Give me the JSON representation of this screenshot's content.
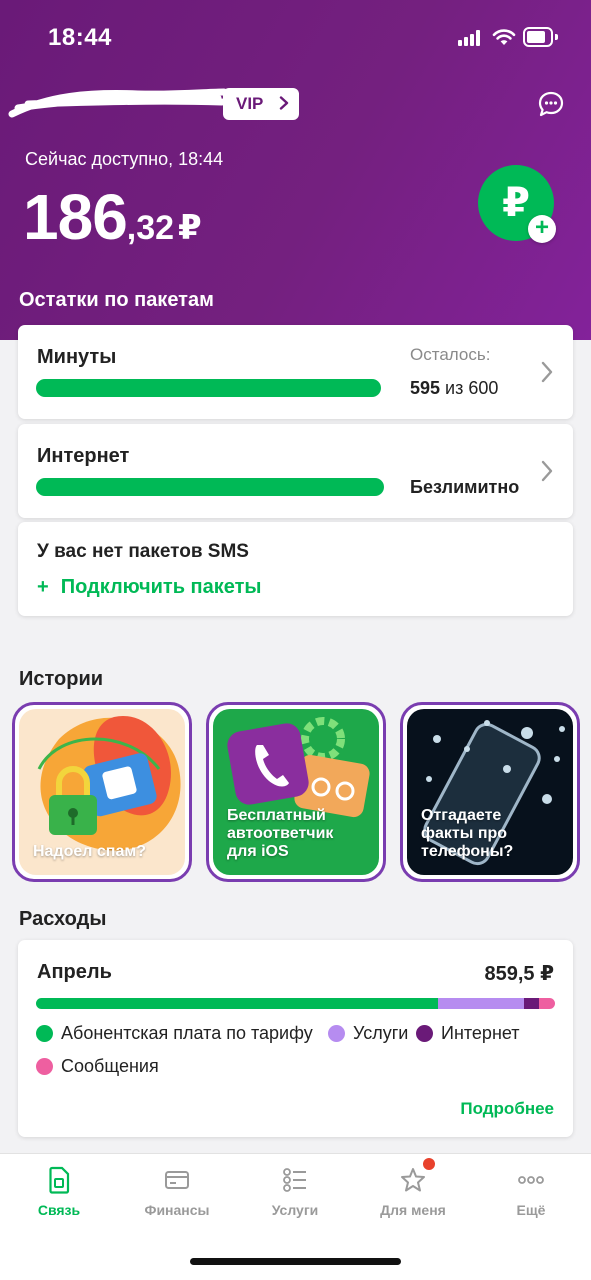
{
  "status_bar": {
    "time": "18:44"
  },
  "header": {
    "vip_label": "VIP",
    "balance_caption": "Сейчас доступно, 18:44",
    "balance_integer": "186",
    "balance_fraction": ",32",
    "currency": "₽",
    "topup_symbol": "₽",
    "topup_plus": "+",
    "packages_title": "Остатки по пакетам"
  },
  "packages": {
    "minutes": {
      "title": "Минуты",
      "remain_label": "Осталось:",
      "remain_used": "595",
      "remain_rest": " из 600",
      "fraction": 0.99
    },
    "internet": {
      "title": "Интернет",
      "remain_text": "Безлимитно",
      "fraction": 1.0
    },
    "sms": {
      "title": "У вас нет пакетов SMS",
      "link_plus": "+",
      "link_text": "Подключить пакеты"
    }
  },
  "stories": {
    "title": "Истории",
    "items": [
      {
        "text": "Надоел спам?"
      },
      {
        "text": "Бесплатный\nавтоответчик\nдля iOS"
      },
      {
        "text": "Отгадаете\nфакты про\nтелефоны?"
      }
    ]
  },
  "expenses": {
    "title": "Расходы",
    "month": "Апрель",
    "total": "859,5 ₽",
    "segments": [
      {
        "label": "Абонентская плата по тарифу",
        "color": "#00b956",
        "share": 0.775
      },
      {
        "label": "Услуги",
        "color": "#b68cf0",
        "share": 0.165
      },
      {
        "label": "Интернет",
        "color": "#6a1a78",
        "share": 0.03
      },
      {
        "label": "Сообщения",
        "color": "#ee5fa0",
        "share": 0.03
      }
    ],
    "more_label": "Подробнее"
  },
  "tabbar": {
    "items": [
      {
        "label": "Связь",
        "icon": "sim-card-icon",
        "active": true
      },
      {
        "label": "Финансы",
        "icon": "card-icon",
        "active": false
      },
      {
        "label": "Услуги",
        "icon": "services-list-icon",
        "active": false
      },
      {
        "label": "Для меня",
        "icon": "star-icon",
        "active": false
      },
      {
        "label": "Ещё",
        "icon": "more-dots-icon",
        "active": false
      }
    ]
  },
  "colors": {
    "brand_green": "#00b956",
    "brand_purple": "#6a1a78",
    "header_gradient_end": "#83229a",
    "background": "#f2f2f4",
    "notification": "#e8412c"
  }
}
